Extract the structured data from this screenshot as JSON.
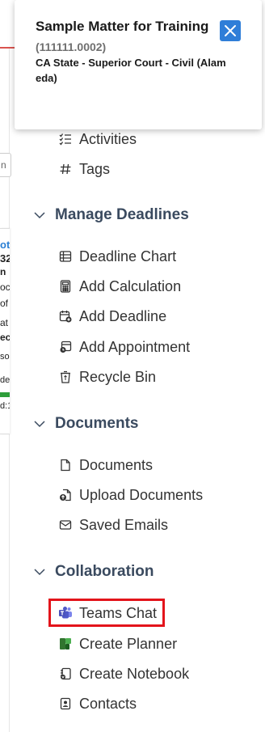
{
  "popup": {
    "title": "Sample Matter for Training",
    "matter_number": "(111111.0002)",
    "court": "CA State - Superior Court - Civil (Alameda)",
    "close_icon": "close-icon",
    "accent_color": "#2f7ed8"
  },
  "background_fragments": [
    "n",
    "ot",
    "32",
    "n",
    "oc",
    "of",
    "at",
    "ec",
    "so",
    "de",
    "d:1"
  ],
  "menu": {
    "top_items": [
      {
        "label": "Activities",
        "icon": "checklist-icon"
      },
      {
        "label": "Tags",
        "icon": "hash-icon"
      }
    ],
    "sections": [
      {
        "label": "Manage Deadlines",
        "expanded": true,
        "items": [
          {
            "label": "Deadline Chart",
            "icon": "table-icon"
          },
          {
            "label": "Add Calculation",
            "icon": "calculator-icon"
          },
          {
            "label": "Add Deadline",
            "icon": "calendar-add-icon"
          },
          {
            "label": "Add Appointment",
            "icon": "appointment-icon"
          },
          {
            "label": "Recycle Bin",
            "icon": "recycle-bin-icon"
          }
        ]
      },
      {
        "label": "Documents",
        "expanded": true,
        "items": [
          {
            "label": "Documents",
            "icon": "document-icon"
          },
          {
            "label": "Upload Documents",
            "icon": "upload-icon"
          },
          {
            "label": "Saved Emails",
            "icon": "mail-icon"
          }
        ]
      },
      {
        "label": "Collaboration",
        "expanded": true,
        "items": [
          {
            "label": "Teams Chat",
            "icon": "teams-icon",
            "highlighted": true
          },
          {
            "label": "Create Planner",
            "icon": "planner-icon"
          },
          {
            "label": "Create Notebook",
            "icon": "notebook-icon"
          },
          {
            "label": "Contacts",
            "icon": "contact-card-icon"
          }
        ]
      }
    ]
  },
  "colors": {
    "section_heading": "#3a4a5f",
    "highlight_border": "#e3141b",
    "teams_purple": "#5059c9",
    "planner_green": "#31752f"
  }
}
